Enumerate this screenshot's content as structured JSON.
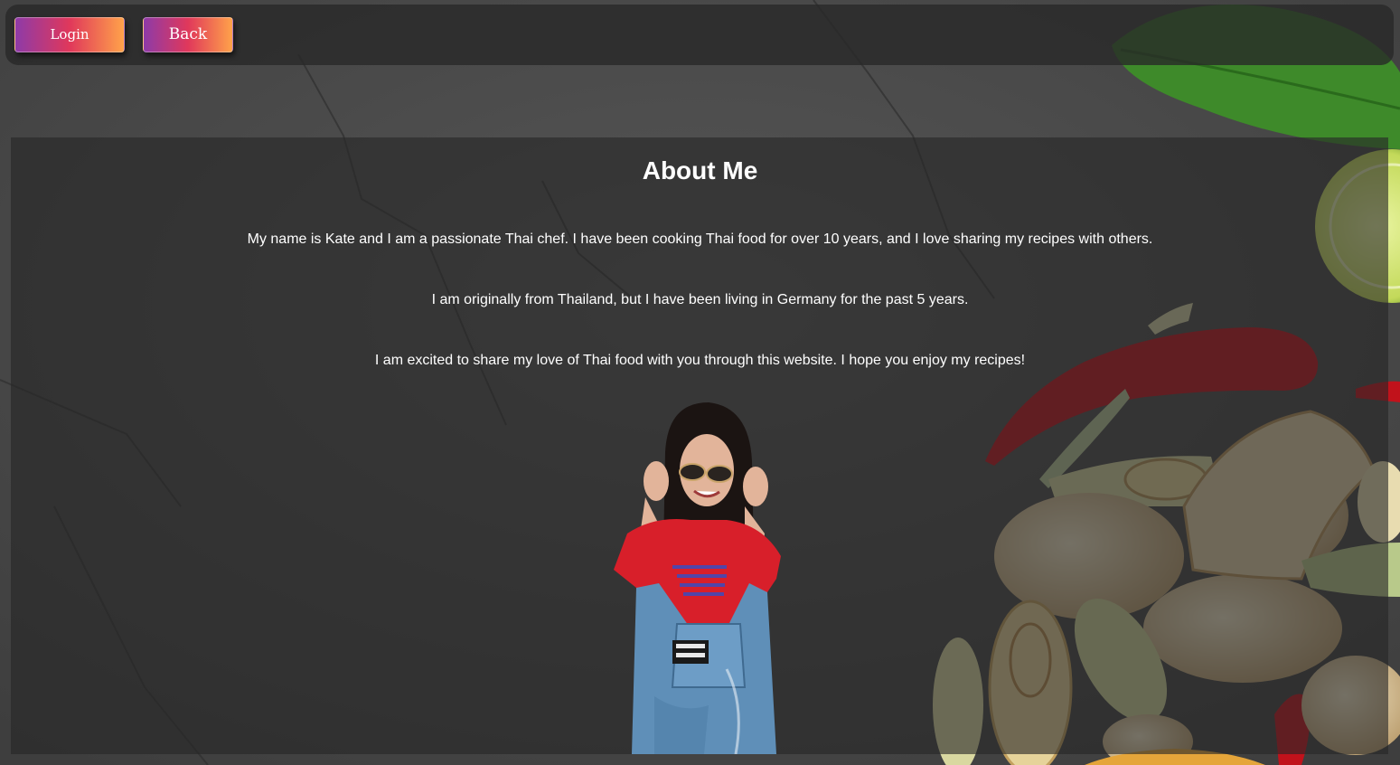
{
  "nav": {
    "login_label": "Login",
    "back_label": "Back"
  },
  "about": {
    "title": "About Me",
    "paragraphs": [
      "My name is Kate and I am a passionate Thai chef. I have been cooking Thai food for over 10 years, and I love sharing my recipes with others.",
      "I am originally from Thailand, but I have been living in Germany for the past 5 years.",
      "I am excited to share my love of Thai food with you through this website. I hope you enjoy my recipes!"
    ]
  },
  "colors": {
    "button_gradient": [
      "#8e3aa8",
      "#e0385b",
      "#ffa24a"
    ],
    "text": "#ffffff"
  },
  "icons": {
    "background": "stone-texture-with-thai-ingredients",
    "photo": "chef-portrait"
  }
}
